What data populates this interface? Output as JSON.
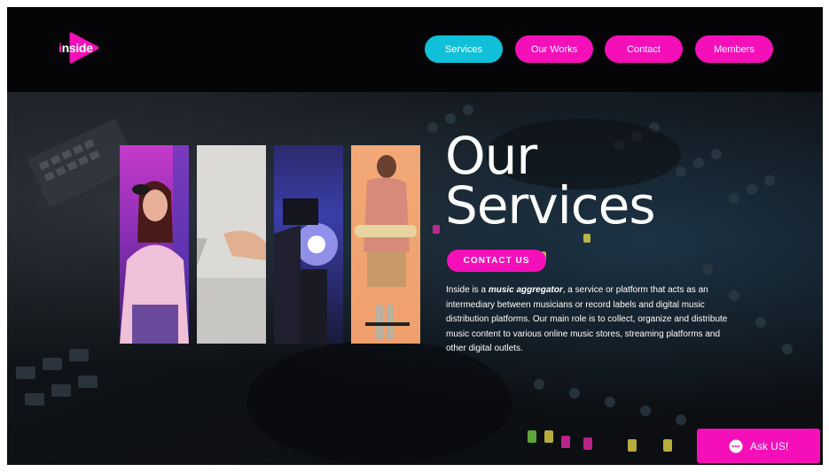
{
  "brand": {
    "logo_text_i": "i",
    "logo_text_rest": "nside",
    "pink": "#f50fb9",
    "cyan": "#0fc0d8"
  },
  "nav": {
    "items": [
      {
        "label": "Services",
        "active": true
      },
      {
        "label": "Our Works",
        "active": false
      },
      {
        "label": "Contact",
        "active": false
      },
      {
        "label": "Members",
        "active": false
      }
    ]
  },
  "hero": {
    "title_line1": "Our",
    "title_line2": "Services",
    "cta_label": "CONTACT US",
    "desc_prefix": "Inside is a ",
    "desc_emphasis": "music aggregator",
    "desc_rest": ", a service or platform that acts as an intermediary between musicians or record labels and digital music distribution platforms. Our main role is to collect, organize and distribute music content to various online music stores, streaming platforms and other digital outlets."
  },
  "chat": {
    "label": "Ask US!",
    "icon": "chat-bubble-icon"
  }
}
